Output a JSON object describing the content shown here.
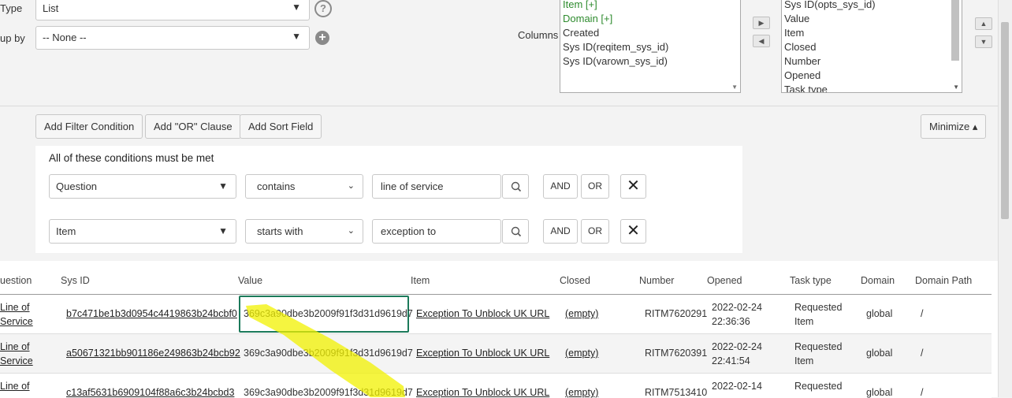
{
  "form": {
    "type_label": "Type",
    "type_value": "List",
    "group_label": "up by",
    "group_value": "-- None --",
    "columns_label": "Columns"
  },
  "available_columns": [
    "Item [+]",
    "Domain [+]",
    "Created",
    "Sys ID(reqitem_sys_id)",
    "Sys ID(varown_sys_id)"
  ],
  "selected_columns": [
    "Sys ID(opts_sys_id)",
    "Value",
    "Item",
    "Closed",
    "Number",
    "Opened",
    "Task type"
  ],
  "filter_toolbar": {
    "add_filter": "Add Filter Condition",
    "add_or": "Add \"OR\" Clause",
    "add_sort": "Add Sort Field",
    "minimize": "Minimize ▴"
  },
  "conditions": {
    "heading": "All of these conditions must be met",
    "items": [
      {
        "field": "Question",
        "operator": "contains",
        "value": "line of service",
        "and": "AND",
        "or": "OR"
      },
      {
        "field": "Item",
        "operator": "starts with",
        "value": "exception to",
        "and": "AND",
        "or": "OR"
      }
    ]
  },
  "table": {
    "headers": [
      "uestion",
      "Sys ID",
      "Value",
      "Item",
      "Closed",
      "Number",
      "Opened",
      "Task type",
      "Domain",
      "Domain Path"
    ],
    "rows": [
      {
        "question1": "Line of",
        "question2": "Service",
        "sys_id": "b7c471be1b3d0954c4419863b24bcbf0",
        "value": "369c3a90dbe3b2009f91f3d31d9619d7",
        "item": "Exception To Unblock UK URL",
        "closed": "(empty)",
        "number": "RITM7620291",
        "opened1": "2022-02-24",
        "opened2": "22:36:36",
        "task1": "Requested",
        "task2": "Item",
        "domain": "global",
        "path": "/"
      },
      {
        "question1": "Line of",
        "question2": "Service",
        "sys_id": "a50671321bb901186e249863b24bcb92",
        "value": "369c3a90dbe3b2009f91f3d31d9619d7",
        "item": "Exception To Unblock UK URL",
        "closed": "(empty)",
        "number": "RITM7620391",
        "opened1": "2022-02-24",
        "opened2": "22:41:54",
        "task1": "Requested",
        "task2": "Item",
        "domain": "global",
        "path": "/"
      },
      {
        "question1": "Line of",
        "question2": "",
        "sys_id": "c13af5631b6909104f88a6c3b24bcbd3",
        "value": "369c3a90dbe3b2009f91f3d31d9619d7",
        "item": "Exception To Unblock UK URL",
        "closed": "(empty)",
        "number": "RITM7513410",
        "opened1": "2022-02-14",
        "opened2": "",
        "task1": "Requested",
        "task2": "",
        "domain": "global",
        "path": "/"
      }
    ]
  },
  "colors": {
    "highlight": "#f2f200",
    "selected_cell_border": "#1b7a5a",
    "row_alt": "#f4f4f4"
  }
}
